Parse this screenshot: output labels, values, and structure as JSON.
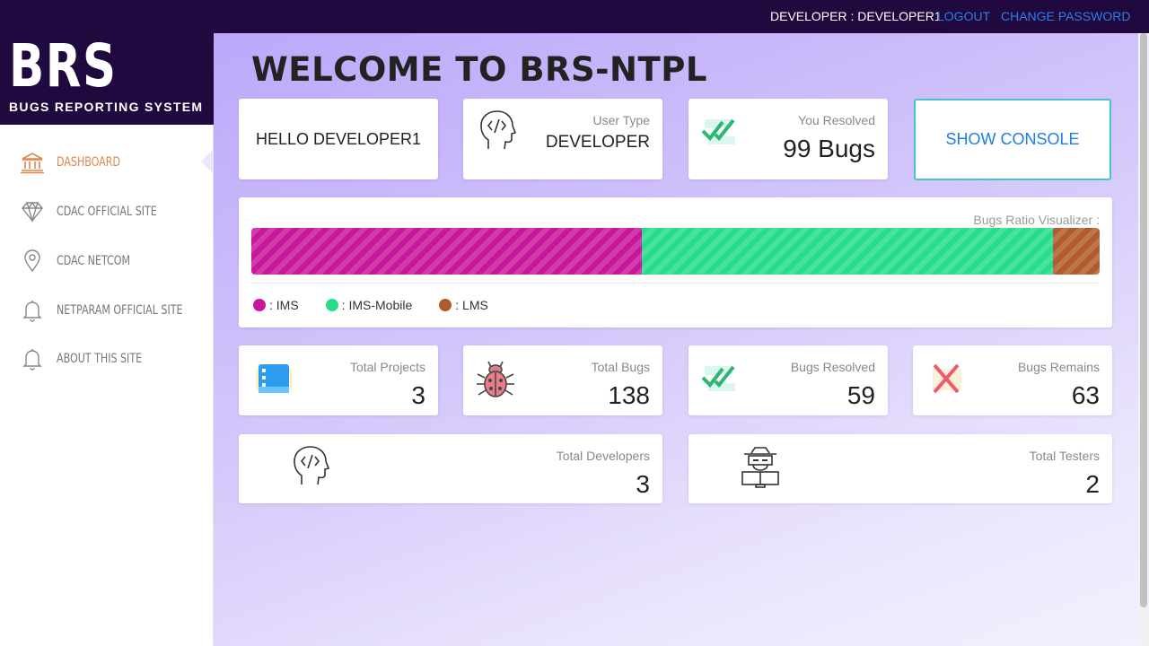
{
  "header": {
    "user_text": "DEVELOPER : DEVELOPER1",
    "logout_label": "LOGOUT",
    "change_password_label": "CHANGE PASSWORD"
  },
  "logo": {
    "title": "BRS",
    "subtitle": "BUGS REPORTING SYSTEM"
  },
  "sidebar": {
    "items": [
      {
        "label": "DASHBOARD",
        "icon": "bank-icon",
        "active": true
      },
      {
        "label": "CDAC OFFICIAL SITE",
        "icon": "diamond-icon"
      },
      {
        "label": "CDAC NETCOM",
        "icon": "map-pin-icon"
      },
      {
        "label": "NETPARAM OFFICIAL SITE",
        "icon": "bell-icon"
      },
      {
        "label": "ABOUT THIS SITE",
        "icon": "bell-icon"
      }
    ]
  },
  "main": {
    "welcome": "WELCOME TO BRS-NTPL",
    "hello": "HELLO DEVELOPER1",
    "user_type": {
      "label": "User Type",
      "value": "DEVELOPER"
    },
    "you_resolved": {
      "label": "You Resolved",
      "value": "99 Bugs"
    },
    "show_console_label": "SHOW CONSOLE",
    "visualizer": {
      "title": "Bugs Ratio Visualizer :",
      "segments": [
        {
          "name": ": IMS",
          "fraction": 0.46,
          "color": "#c8179c"
        },
        {
          "name": ": IMS-Mobile",
          "fraction": 0.485,
          "color": "#26dd8a"
        },
        {
          "name": ": LMS",
          "fraction": 0.055,
          "color": "#b15b2c"
        }
      ]
    },
    "stats": {
      "total_projects": {
        "label": "Total Projects",
        "value": "3"
      },
      "total_bugs": {
        "label": "Total Bugs",
        "value": "138"
      },
      "bugs_resolved": {
        "label": "Bugs Resolved",
        "value": "59"
      },
      "bugs_remains": {
        "label": "Bugs Remains",
        "value": "63"
      },
      "total_developers": {
        "label": "Total Developers",
        "value": "3"
      },
      "total_testers": {
        "label": "Total Testers",
        "value": "2"
      }
    }
  }
}
